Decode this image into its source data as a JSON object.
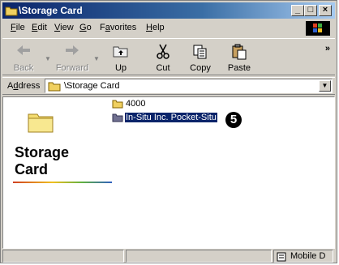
{
  "window": {
    "title": "\\Storage Card",
    "controls": {
      "minimize": "_",
      "maximize": "□",
      "close": "×"
    }
  },
  "menubar": {
    "items": [
      "File",
      "Edit",
      "View",
      "Go",
      "Favorites",
      "Help"
    ],
    "mnemonics": [
      "F",
      "E",
      "V",
      "G",
      "a",
      "H"
    ]
  },
  "toolbar": {
    "buttons": [
      {
        "label": "Back",
        "icon": "back-arrow-icon",
        "enabled": false
      },
      {
        "label": "Forward",
        "icon": "forward-arrow-icon",
        "enabled": false
      },
      {
        "label": "Up",
        "icon": "up-folder-icon",
        "enabled": true
      },
      {
        "label": "Cut",
        "icon": "scissors-icon",
        "enabled": true
      },
      {
        "label": "Copy",
        "icon": "copy-icon",
        "enabled": true
      },
      {
        "label": "Paste",
        "icon": "paste-icon",
        "enabled": true
      }
    ],
    "overflow": "»"
  },
  "address": {
    "label": "Address",
    "value": "\\Storage Card"
  },
  "panel": {
    "title_line1": "Storage",
    "title_line2": "Card"
  },
  "files": [
    {
      "name": "4000",
      "selected": false
    },
    {
      "name": "In-Situ Inc. Pocket-Situ",
      "selected": true
    }
  ],
  "badge": "5",
  "statusbar": {
    "zone": "Mobile D"
  },
  "colors": {
    "titlebar_start": "#0a246a",
    "titlebar_end": "#a6caf0",
    "selection": "#0a246a",
    "chrome": "#d4d0c8"
  }
}
